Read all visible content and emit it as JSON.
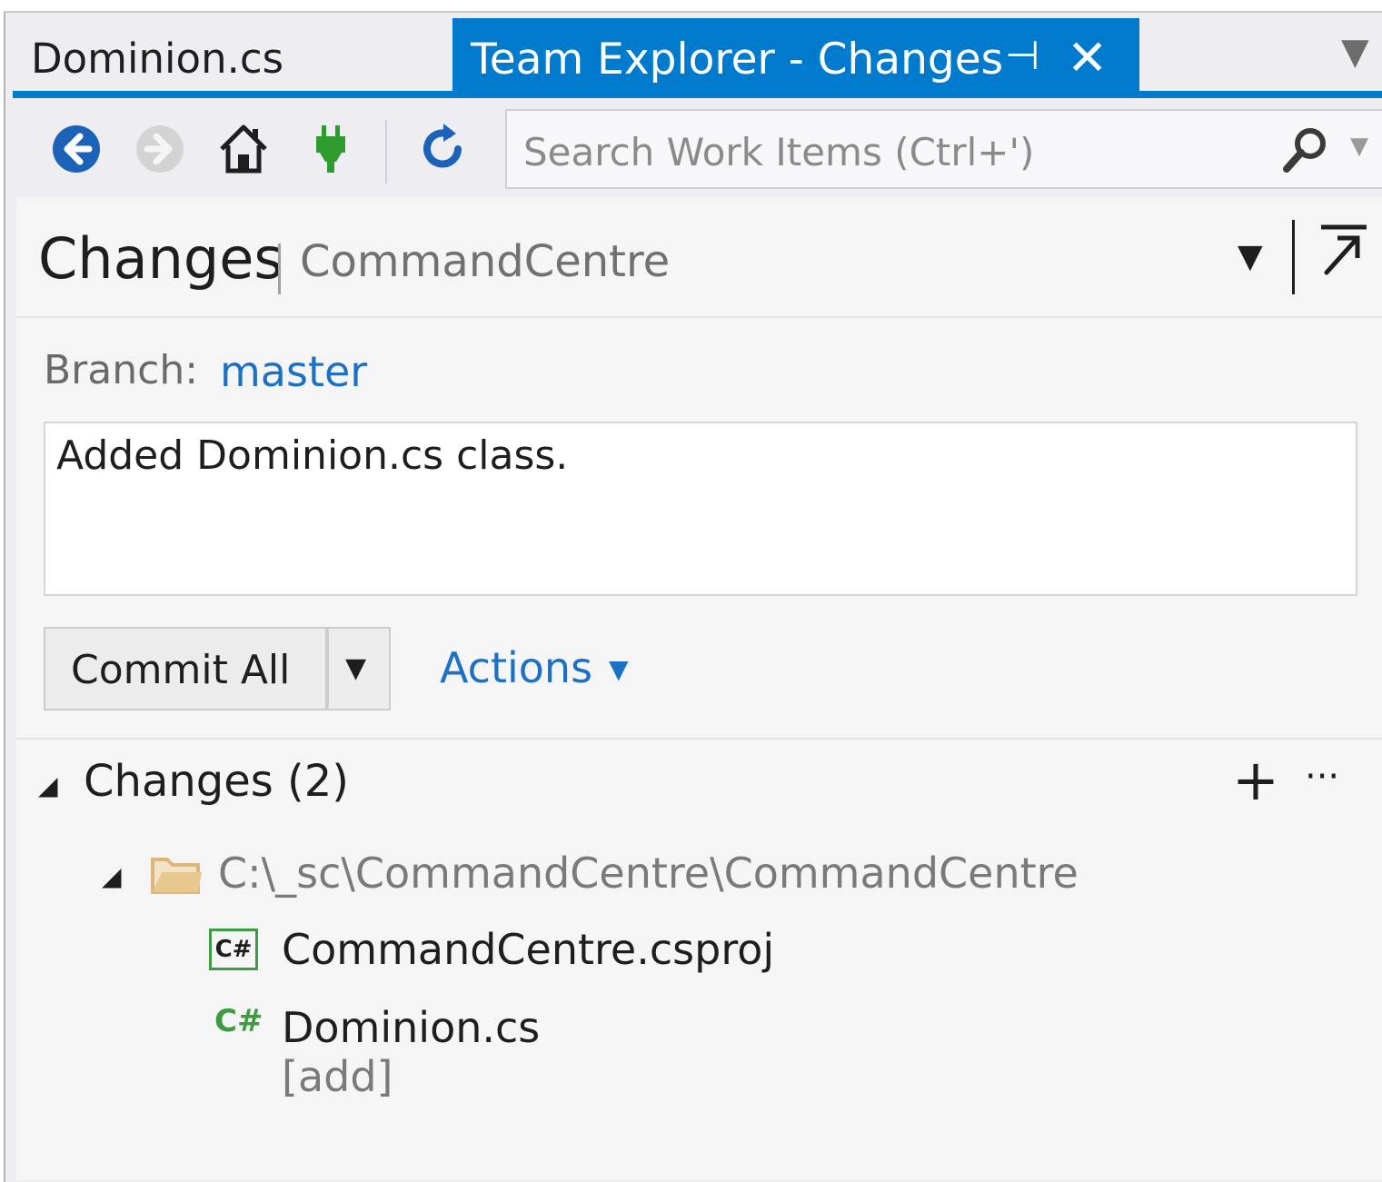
{
  "tabs": [
    {
      "label": "Dominion.cs",
      "active": false
    },
    {
      "label": "Team Explorer - Changes",
      "active": true
    }
  ],
  "toolbar": {
    "icons": [
      "back-arrow-icon",
      "forward-arrow-icon",
      "home-icon",
      "connect-plug-icon",
      "refresh-icon"
    ],
    "search_placeholder": "Search Work Items (Ctrl+')"
  },
  "header": {
    "title": "Changes",
    "subtitle": "CommandCentre"
  },
  "branch": {
    "label": "Branch:",
    "value": "master"
  },
  "commit": {
    "message": "Added Dominion.cs class.",
    "button_label": "Commit All",
    "actions_label": "Actions"
  },
  "changes": {
    "header": "Changes (2)",
    "folder": "C:\\_sc\\CommandCentre\\CommandCentre",
    "files": [
      {
        "name": "CommandCentre.csproj",
        "status": "",
        "icon": "csproj-icon"
      },
      {
        "name": "Dominion.cs",
        "status": "[add]",
        "icon": "csharp-file-icon"
      }
    ]
  },
  "colors": {
    "accent": "#007acc",
    "link": "#1c71c4",
    "csharp_green": "#3f9b3f",
    "folder": "#dcb67a"
  }
}
